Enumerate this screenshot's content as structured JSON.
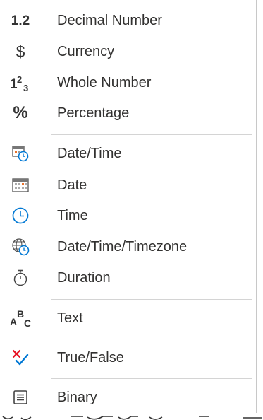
{
  "menu": {
    "items": [
      {
        "label": "Decimal Number",
        "icon": "decimal-number-icon"
      },
      {
        "label": "Currency",
        "icon": "currency-icon"
      },
      {
        "label": "Whole Number",
        "icon": "whole-number-icon"
      },
      {
        "label": "Percentage",
        "icon": "percentage-icon"
      },
      {
        "label": "Date/Time",
        "icon": "datetime-icon"
      },
      {
        "label": "Date",
        "icon": "date-icon"
      },
      {
        "label": "Time",
        "icon": "time-icon"
      },
      {
        "label": "Date/Time/Timezone",
        "icon": "datetime-timezone-icon"
      },
      {
        "label": "Duration",
        "icon": "duration-icon"
      },
      {
        "label": "Text",
        "icon": "text-icon"
      },
      {
        "label": "True/False",
        "icon": "true-false-icon"
      },
      {
        "label": "Binary",
        "icon": "binary-icon"
      }
    ],
    "icon_text": {
      "decimal": "1.2",
      "currency": "$",
      "percent": "%"
    }
  },
  "colors": {
    "text": "#323130",
    "icon_dark": "#333333",
    "accent_blue": "#0078d4",
    "accent_red": "#e81123",
    "separator": "#d4d4d4"
  }
}
